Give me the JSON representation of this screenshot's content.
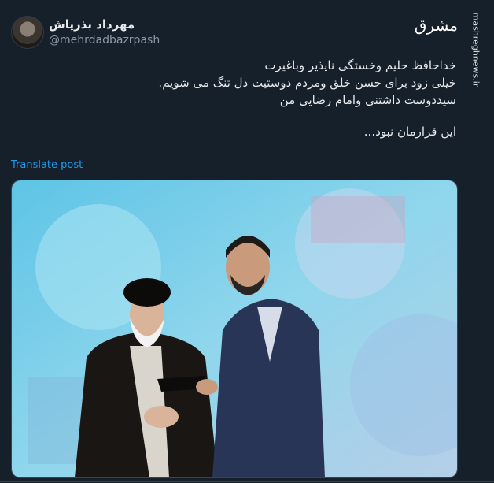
{
  "author": {
    "name": "مهرداد بذرپاش",
    "handle": "@mehrdadbazrpash"
  },
  "watermark": {
    "logo_text": "مشرق",
    "site": "mashreghnews.ir"
  },
  "tweet": {
    "lines": [
      "خداحافظ حلیم وخستگی ناپذیر وباغیرت",
      "خیلی زود برای حسن خلق ومردم دوستیت دل تنگ می شویم.",
      "سیددوست داشتنی وامام رضایی من",
      "این قرارمان نبود..."
    ]
  },
  "translate_label": "Translate post",
  "colors": {
    "background": "#15202b",
    "text": "#e7e9ea",
    "secondary": "#8b98a5",
    "link": "#1d9bf0",
    "border": "#38444d"
  }
}
